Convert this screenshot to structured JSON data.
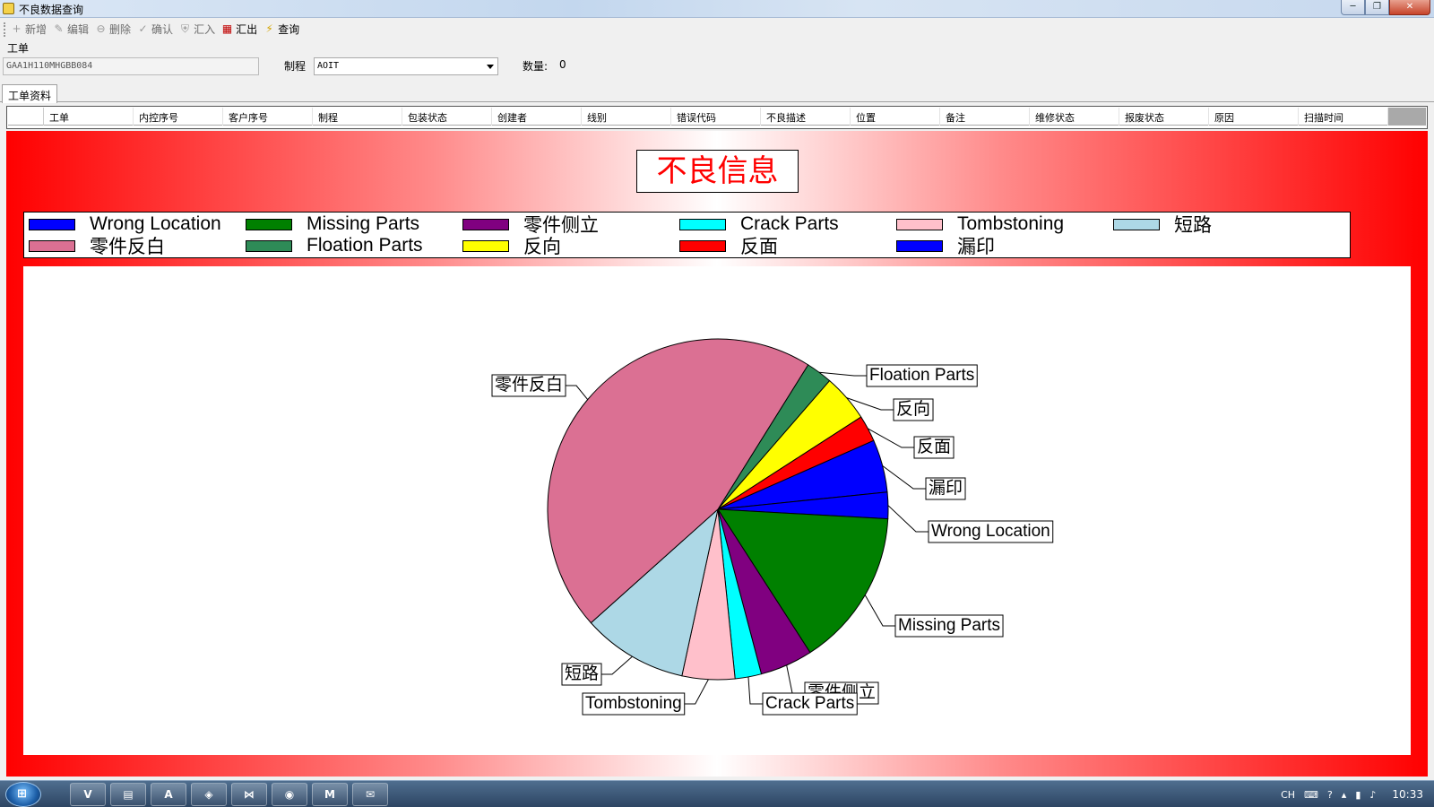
{
  "window": {
    "title": "不良数据查询",
    "controls": [
      "─",
      "❐",
      "✕"
    ]
  },
  "toolbar": [
    {
      "id": "add",
      "label": "新增",
      "icon": "add-icon",
      "glyph": "+",
      "enabled": false
    },
    {
      "id": "edit",
      "label": "编辑",
      "icon": "wrench-icon",
      "glyph": "✎",
      "enabled": false
    },
    {
      "id": "delete",
      "label": "删除",
      "icon": "delete-icon",
      "glyph": "⊖",
      "enabled": false
    },
    {
      "id": "confirm",
      "label": "确认",
      "icon": "confirm-icon",
      "glyph": "✓",
      "enabled": false
    },
    {
      "id": "import",
      "label": "汇入",
      "icon": "import-icon",
      "glyph": "⛨",
      "enabled": false
    },
    {
      "id": "export",
      "label": "汇出",
      "icon": "export-icon",
      "glyph": "▦",
      "enabled": true
    },
    {
      "id": "query",
      "label": "查询",
      "icon": "query-icon",
      "glyph": "⚡",
      "enabled": true
    }
  ],
  "form": {
    "work_order_label": "工单",
    "work_order_value": "GAA1H110MHGBB084",
    "process_label": "制程",
    "process_value": "AOIT",
    "quantity_label": "数量:",
    "quantity_value": "0"
  },
  "tabs": [
    {
      "label": "工单资料",
      "active": true
    }
  ],
  "grid": {
    "columns": [
      "工单",
      "内控序号",
      "客户序号",
      "制程",
      "包装状态",
      "创建者",
      "线别",
      "错误代码",
      "不良描述",
      "位置",
      "备注",
      "维修状态",
      "报废状态",
      "原因",
      "扫描时间"
    ]
  },
  "chart_data": {
    "type": "pie",
    "title": "不良信息",
    "legend_position": "top",
    "legend": [
      {
        "name": "Wrong Location",
        "color": "#0000ff"
      },
      {
        "name": "Missing Parts",
        "color": "#008000"
      },
      {
        "name": "零件侧立",
        "color": "#800080"
      },
      {
        "name": "Crack Parts",
        "color": "#00ffff"
      },
      {
        "name": "Tombstoning",
        "color": "#ffc0cb"
      },
      {
        "name": "短路",
        "color": "#add8e6"
      },
      {
        "name": "零件反白",
        "color": "#db7093"
      },
      {
        "name": "Floation Parts",
        "color": "#2e8b57"
      },
      {
        "name": "反向",
        "color": "#ffff00"
      },
      {
        "name": "反面",
        "color": "#ff0000"
      },
      {
        "name": "漏印",
        "color": "#0000ff"
      }
    ],
    "slices": [
      {
        "name": "Floation Parts",
        "value": 2.5,
        "color": "#2e8b57"
      },
      {
        "name": "反向",
        "value": 4.5,
        "color": "#ffff00"
      },
      {
        "name": "反面",
        "value": 2.5,
        "color": "#ff0000"
      },
      {
        "name": "漏印",
        "value": 5,
        "color": "#0000ff"
      },
      {
        "name": "Wrong Location",
        "value": 2.5,
        "color": "#0000ff"
      },
      {
        "name": "Missing Parts",
        "value": 15,
        "color": "#008000"
      },
      {
        "name": "零件侧立",
        "value": 5,
        "color": "#800080"
      },
      {
        "name": "Crack Parts",
        "value": 2.5,
        "color": "#00ffff"
      },
      {
        "name": "Tombstoning",
        "value": 5,
        "color": "#ffc0cb"
      },
      {
        "name": "短路",
        "value": 10,
        "color": "#add8e6"
      },
      {
        "name": "零件反白",
        "value": 45.5,
        "color": "#db7093"
      }
    ]
  },
  "taskbar": {
    "start_label": "⊞",
    "apps": [
      {
        "name": "vs-icon",
        "glyph": "V"
      },
      {
        "name": "explorer-icon",
        "glyph": "▤"
      },
      {
        "name": "pdf-icon",
        "glyph": "A"
      },
      {
        "name": "app-icon",
        "glyph": "◈"
      },
      {
        "name": "visual-studio-icon",
        "glyph": "⋈"
      },
      {
        "name": "chrome-icon",
        "glyph": "◉"
      },
      {
        "name": "m-icon",
        "glyph": "M"
      },
      {
        "name": "wechat-icon",
        "glyph": "✉"
      }
    ],
    "tray": {
      "lang": "CH",
      "clock": "10:33"
    }
  }
}
